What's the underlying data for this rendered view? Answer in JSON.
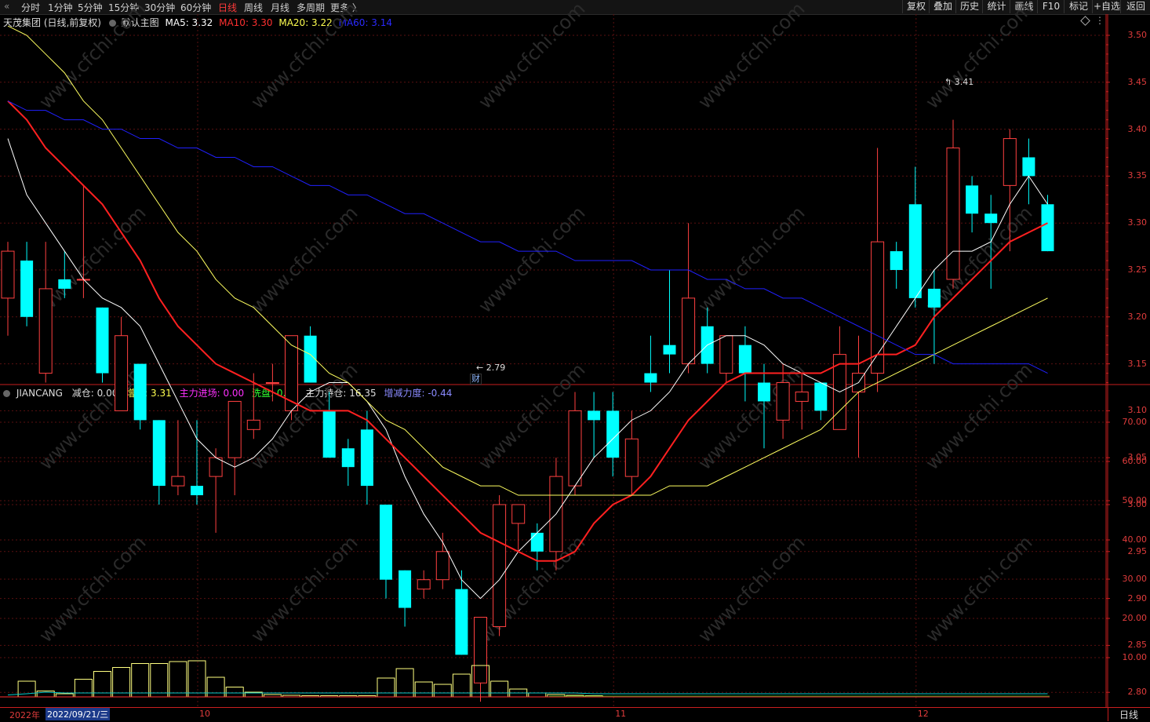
{
  "toolbar": {
    "left_tabs": [
      "分时",
      "1分钟",
      "5分钟",
      "15分钟",
      "30分钟",
      "60分钟",
      "日线",
      "周线",
      "月线",
      "多周期",
      "更多 〉"
    ],
    "active_tab": "日线",
    "right_buttons": [
      "复权",
      "叠加",
      "历史",
      "统计",
      "画线",
      "F10",
      "标记",
      "+自选",
      "返回"
    ]
  },
  "main_header": {
    "stock": "天茂集团 (日线,前复权)",
    "template": "默认主图",
    "ma5": "MA5: 3.32",
    "ma10": "MA10: 3.30",
    "ma20": "MA20: 3.22",
    "ma60": "MA60: 3.14"
  },
  "sub_header": {
    "name": "JIANCANG",
    "jiancang": "减仓: 0.00",
    "zengcang": "增仓: 3.31",
    "zhuli_jinchang": "主力进场: 0.00",
    "xipan": "洗盘: 0.00",
    "zhuli_chicang": "主力持仓: 16.35",
    "zengjian_lidu": "增减力度: -0.44"
  },
  "annotations": {
    "high": "3.41",
    "low": "2.79",
    "cai": "财"
  },
  "bottom_bar": {
    "year": "2022年",
    "cursor_date": "2022/09/21/三",
    "months": [
      "10",
      "11",
      "12"
    ],
    "period": "日线"
  },
  "colors": {
    "up": "#ff4040",
    "down": "#00ffff",
    "ma5": "#ffffff",
    "ma10": "#ff2020",
    "ma20": "#ffff60",
    "ma60": "#2020ff",
    "axis": "#c81e1e"
  },
  "chart_data": [
    {
      "type": "candlestick",
      "title": "天茂集团 (日线,前复权)",
      "ylim": [
        2.76,
        3.53
      ],
      "yticks": [
        "3.50",
        "3.45",
        "3.40",
        "3.35",
        "3.30",
        "3.25",
        "3.20",
        "3.15",
        "3.10",
        "3.05",
        "3.00",
        "2.95",
        "2.90",
        "2.85",
        "2.80"
      ],
      "candles": [
        {
          "o": 3.22,
          "h": 3.28,
          "l": 3.18,
          "c": 3.27
        },
        {
          "o": 3.26,
          "h": 3.28,
          "l": 3.19,
          "c": 3.2
        },
        {
          "o": 3.14,
          "h": 3.28,
          "l": 3.13,
          "c": 3.23
        },
        {
          "o": 3.24,
          "h": 3.27,
          "l": 3.22,
          "c": 3.23
        },
        {
          "o": 3.24,
          "h": 3.34,
          "l": 3.22,
          "c": 3.24
        },
        {
          "o": 3.21,
          "h": 3.21,
          "l": 3.13,
          "c": 3.14
        },
        {
          "o": 3.1,
          "h": 3.2,
          "l": 3.1,
          "c": 3.18
        },
        {
          "o": 3.15,
          "h": 3.15,
          "l": 3.08,
          "c": 3.09
        },
        {
          "o": 3.09,
          "h": 3.09,
          "l": 3.0,
          "c": 3.02
        },
        {
          "o": 3.02,
          "h": 3.09,
          "l": 3.01,
          "c": 3.03
        },
        {
          "o": 3.02,
          "h": 3.09,
          "l": 3.0,
          "c": 3.01
        },
        {
          "o": 3.03,
          "h": 3.06,
          "l": 2.97,
          "c": 3.05
        },
        {
          "o": 3.05,
          "h": 3.1,
          "l": 3.01,
          "c": 3.11
        },
        {
          "o": 3.08,
          "h": 3.14,
          "l": 3.07,
          "c": 3.09
        },
        {
          "o": 3.13,
          "h": 3.15,
          "l": 3.11,
          "c": 3.13
        },
        {
          "o": 3.1,
          "h": 3.18,
          "l": 3.09,
          "c": 3.18
        },
        {
          "o": 3.18,
          "h": 3.19,
          "l": 3.13,
          "c": 3.13
        },
        {
          "o": 3.1,
          "h": 3.12,
          "l": 3.05,
          "c": 3.05
        },
        {
          "o": 3.06,
          "h": 3.07,
          "l": 3.02,
          "c": 3.04
        },
        {
          "o": 3.08,
          "h": 3.1,
          "l": 3.0,
          "c": 3.02
        },
        {
          "o": 3.0,
          "h": 3.0,
          "l": 2.9,
          "c": 2.92
        },
        {
          "o": 2.93,
          "h": 2.93,
          "l": 2.87,
          "c": 2.89
        },
        {
          "o": 2.91,
          "h": 2.93,
          "l": 2.9,
          "c": 2.92
        },
        {
          "o": 2.92,
          "h": 2.97,
          "l": 2.91,
          "c": 2.95
        },
        {
          "o": 2.91,
          "h": 2.93,
          "l": 2.84,
          "c": 2.84
        },
        {
          "o": 2.81,
          "h": 2.88,
          "l": 2.79,
          "c": 2.88
        },
        {
          "o": 2.87,
          "h": 3.01,
          "l": 2.86,
          "c": 3.0
        },
        {
          "o": 2.98,
          "h": 3.0,
          "l": 2.95,
          "c": 3.0
        },
        {
          "o": 2.97,
          "h": 2.98,
          "l": 2.93,
          "c": 2.95
        },
        {
          "o": 2.95,
          "h": 3.05,
          "l": 2.93,
          "c": 3.03
        },
        {
          "o": 3.02,
          "h": 3.12,
          "l": 3.01,
          "c": 3.1
        },
        {
          "o": 3.1,
          "h": 3.12,
          "l": 3.05,
          "c": 3.09
        },
        {
          "o": 3.1,
          "h": 3.12,
          "l": 3.03,
          "c": 3.05
        },
        {
          "o": 3.03,
          "h": 3.1,
          "l": 3.01,
          "c": 3.07
        },
        {
          "o": 3.14,
          "h": 3.18,
          "l": 3.12,
          "c": 3.13
        },
        {
          "o": 3.17,
          "h": 3.25,
          "l": 3.14,
          "c": 3.16
        },
        {
          "o": 3.15,
          "h": 3.3,
          "l": 3.14,
          "c": 3.22
        },
        {
          "o": 3.19,
          "h": 3.21,
          "l": 3.14,
          "c": 3.15
        },
        {
          "o": 3.14,
          "h": 3.17,
          "l": 3.13,
          "c": 3.18
        },
        {
          "o": 3.17,
          "h": 3.19,
          "l": 3.11,
          "c": 3.14
        },
        {
          "o": 3.13,
          "h": 3.15,
          "l": 3.06,
          "c": 3.11
        },
        {
          "o": 3.09,
          "h": 3.15,
          "l": 3.07,
          "c": 3.13
        },
        {
          "o": 3.11,
          "h": 3.14,
          "l": 3.08,
          "c": 3.12
        },
        {
          "o": 3.13,
          "h": 3.13,
          "l": 3.09,
          "c": 3.1
        },
        {
          "o": 3.08,
          "h": 3.19,
          "l": 3.08,
          "c": 3.16
        },
        {
          "o": 3.12,
          "h": 3.18,
          "l": 3.05,
          "c": 3.14
        },
        {
          "o": 3.14,
          "h": 3.38,
          "l": 3.12,
          "c": 3.28
        },
        {
          "o": 3.27,
          "h": 3.28,
          "l": 3.23,
          "c": 3.25
        },
        {
          "o": 3.32,
          "h": 3.36,
          "l": 3.21,
          "c": 3.22
        },
        {
          "o": 3.23,
          "h": 3.25,
          "l": 3.15,
          "c": 3.21
        },
        {
          "o": 3.24,
          "h": 3.41,
          "l": 3.23,
          "c": 3.38
        },
        {
          "o": 3.34,
          "h": 3.35,
          "l": 3.29,
          "c": 3.31
        },
        {
          "o": 3.31,
          "h": 3.33,
          "l": 3.23,
          "c": 3.3
        },
        {
          "o": 3.34,
          "h": 3.4,
          "l": 3.27,
          "c": 3.39
        },
        {
          "o": 3.37,
          "h": 3.39,
          "l": 3.32,
          "c": 3.35
        },
        {
          "o": 3.32,
          "h": 3.33,
          "l": 3.27,
          "c": 3.27
        }
      ],
      "series": [
        {
          "name": "MA5",
          "values": [
            3.39,
            3.33,
            3.3,
            3.27,
            3.24,
            3.22,
            3.21,
            3.19,
            3.15,
            3.11,
            3.07,
            3.05,
            3.04,
            3.05,
            3.07,
            3.1,
            3.12,
            3.13,
            3.13,
            3.11,
            3.08,
            3.03,
            2.99,
            2.96,
            2.92,
            2.9,
            2.92,
            2.95,
            2.97,
            2.99,
            3.02,
            3.05,
            3.07,
            3.09,
            3.1,
            3.12,
            3.15,
            3.17,
            3.18,
            3.18,
            3.17,
            3.15,
            3.14,
            3.13,
            3.12,
            3.13,
            3.16,
            3.19,
            3.22,
            3.25,
            3.27,
            3.27,
            3.28,
            3.32,
            3.35,
            3.32
          ]
        },
        {
          "name": "MA10",
          "values": [
            3.43,
            3.41,
            3.38,
            3.36,
            3.34,
            3.32,
            3.29,
            3.26,
            3.22,
            3.19,
            3.17,
            3.15,
            3.14,
            3.13,
            3.12,
            3.11,
            3.1,
            3.1,
            3.1,
            3.09,
            3.07,
            3.05,
            3.03,
            3.01,
            2.99,
            2.97,
            2.96,
            2.95,
            2.94,
            2.94,
            2.95,
            2.98,
            3.0,
            3.01,
            3.03,
            3.06,
            3.09,
            3.11,
            3.13,
            3.14,
            3.14,
            3.14,
            3.14,
            3.14,
            3.15,
            3.15,
            3.16,
            3.16,
            3.17,
            3.2,
            3.22,
            3.24,
            3.26,
            3.28,
            3.29,
            3.3
          ]
        },
        {
          "name": "MA20",
          "values": [
            3.51,
            3.5,
            3.48,
            3.46,
            3.43,
            3.41,
            3.38,
            3.35,
            3.32,
            3.29,
            3.27,
            3.24,
            3.22,
            3.21,
            3.19,
            3.17,
            3.16,
            3.14,
            3.13,
            3.11,
            3.09,
            3.08,
            3.06,
            3.04,
            3.03,
            3.02,
            3.02,
            3.01,
            3.01,
            3.01,
            3.01,
            3.01,
            3.01,
            3.01,
            3.01,
            3.02,
            3.02,
            3.02,
            3.03,
            3.04,
            3.05,
            3.06,
            3.07,
            3.08,
            3.1,
            3.12,
            3.13,
            3.14,
            3.15,
            3.16,
            3.17,
            3.18,
            3.19,
            3.2,
            3.21,
            3.22
          ]
        },
        {
          "name": "MA60",
          "values": [
            3.43,
            3.42,
            3.42,
            3.41,
            3.41,
            3.4,
            3.4,
            3.39,
            3.39,
            3.38,
            3.38,
            3.37,
            3.37,
            3.36,
            3.36,
            3.35,
            3.34,
            3.34,
            3.33,
            3.33,
            3.32,
            3.31,
            3.31,
            3.3,
            3.29,
            3.28,
            3.28,
            3.27,
            3.27,
            3.27,
            3.26,
            3.26,
            3.26,
            3.26,
            3.25,
            3.25,
            3.25,
            3.24,
            3.24,
            3.23,
            3.23,
            3.22,
            3.22,
            3.21,
            3.2,
            3.19,
            3.18,
            3.17,
            3.16,
            3.16,
            3.15,
            3.15,
            3.15,
            3.15,
            3.15,
            3.14
          ]
        }
      ]
    },
    {
      "type": "bar",
      "title": "JIANCANG",
      "ylim": [
        0,
        80
      ],
      "yticks": [
        "70.00",
        "60.00",
        "50.00",
        "40.00",
        "30.00",
        "20.00",
        "10.00"
      ],
      "series": [
        {
          "name": "增仓",
          "values": [
            0,
            4,
            1.5,
            0.8,
            4.5,
            6.5,
            7.5,
            8.5,
            8.5,
            9,
            9.2,
            5,
            2.5,
            1.2,
            0.6,
            0.4,
            0.3,
            0.3,
            0.3,
            0.3,
            4.8,
            7.2,
            3.8,
            3.2,
            5.8,
            8,
            4,
            2,
            1,
            0.6,
            0.4,
            0.3,
            0.2,
            0.2,
            0.2,
            0.2,
            0.2,
            0.2,
            0.2,
            0.2,
            0.2,
            0.2,
            0.2,
            0.2,
            0.2,
            0.2,
            0.2,
            0.2,
            0.2,
            0.2,
            0.2,
            0.2,
            0.2,
            0.2,
            0.2,
            0.2
          ]
        },
        {
          "name": "主力持仓",
          "values": [
            0.5,
            0.8,
            1.2,
            1,
            1,
            1,
            1,
            1,
            1,
            1,
            1,
            1,
            1,
            1,
            1,
            1,
            1,
            1,
            1,
            1,
            1,
            1,
            1,
            1,
            1,
            1,
            1,
            1,
            1,
            1,
            1,
            0.8,
            0.8,
            0.8,
            0.8,
            0.8,
            0.8,
            0.8,
            0.8,
            0.8,
            0.8,
            0.8,
            0.8,
            0.8,
            0.8,
            0.8,
            0.8,
            0.8,
            0.8,
            0.8,
            0.8,
            0.8,
            0.8,
            0.8,
            0.8,
            0.8
          ]
        }
      ]
    }
  ]
}
